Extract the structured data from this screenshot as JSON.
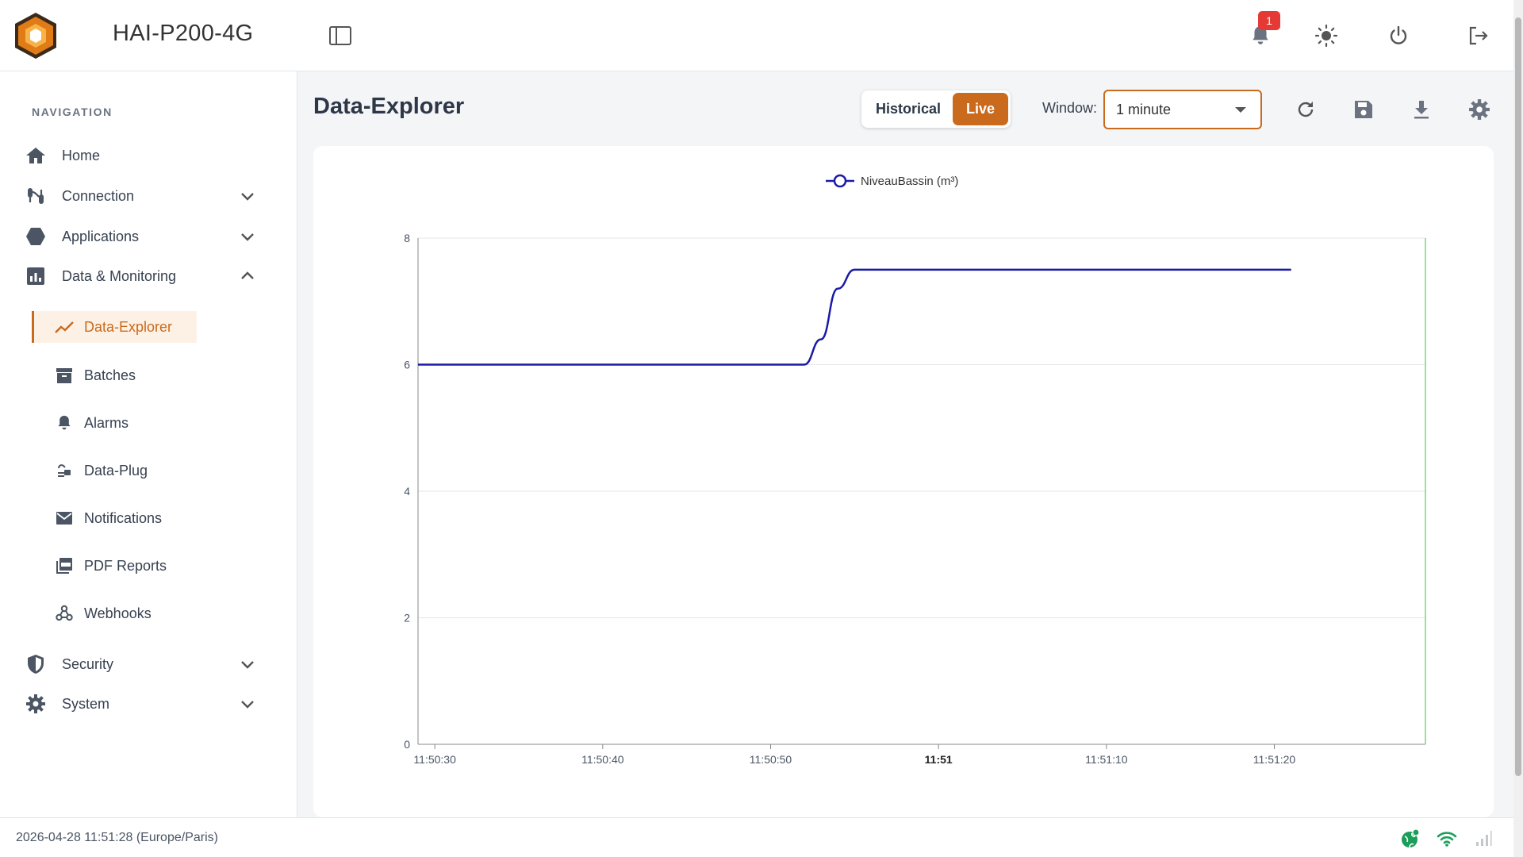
{
  "header": {
    "app_title": "HAI-P200-4G",
    "notification_count": "1",
    "icons": [
      "sidebar-toggle-icon",
      "bell-icon",
      "sun-icon",
      "power-icon",
      "logout-icon"
    ]
  },
  "sidebar": {
    "section_label": "NAVIGATION",
    "items": [
      {
        "label": "Home",
        "icon": "home-icon"
      },
      {
        "label": "Connection",
        "icon": "connection-icon"
      },
      {
        "label": "Applications",
        "icon": "hexagon-icon"
      },
      {
        "label": "Data & Monitoring",
        "icon": "chart-box-icon"
      }
    ],
    "sub_items": [
      {
        "label": "Data-Explorer",
        "icon": "trending-icon",
        "active": true
      },
      {
        "label": "Batches",
        "icon": "archive-icon"
      },
      {
        "label": "Alarms",
        "icon": "bell-icon"
      },
      {
        "label": "Data-Plug",
        "icon": "plug-icon"
      },
      {
        "label": "Notifications",
        "icon": "mail-icon"
      },
      {
        "label": "PDF Reports",
        "icon": "pdf-icon"
      },
      {
        "label": "Webhooks",
        "icon": "webhook-icon"
      }
    ],
    "bottom_items": [
      {
        "label": "Security",
        "icon": "shield-icon"
      },
      {
        "label": "System",
        "icon": "gear-icon"
      }
    ]
  },
  "main": {
    "page_title": "Data-Explorer",
    "mode": {
      "historical_label": "Historical",
      "live_label": "Live",
      "selected": "Live"
    },
    "window_label": "Window:",
    "window_value": "1 minute",
    "toolbar_icons": [
      "refresh-icon",
      "save-icon",
      "download-icon",
      "settings-icon"
    ]
  },
  "colors": {
    "accent": "#c96a1c",
    "series": "#1a1aa6",
    "badge": "#e53935"
  },
  "chart_data": {
    "type": "line",
    "title": "",
    "xlabel": "",
    "ylabel": "",
    "legend": [
      {
        "name": "NiveauBassin (m³)"
      }
    ],
    "legend_position": "top-center",
    "ylim": [
      0,
      8
    ],
    "yticks": [
      0,
      2,
      4,
      6,
      8
    ],
    "xlim": [
      "11:50:29",
      "11:51:29"
    ],
    "xticks": [
      "11:50:30",
      "11:50:40",
      "11:50:50",
      "11:51",
      "11:51:10",
      "11:51:20"
    ],
    "grid": true,
    "series": [
      {
        "name": "NiveauBassin (m³)",
        "x": [
          "11:50:29",
          "11:50:52",
          "11:50:53",
          "11:50:54",
          "11:50:55",
          "11:51:21"
        ],
        "y": [
          6,
          6,
          6.4,
          7.2,
          7.5,
          7.5
        ]
      }
    ]
  },
  "footer": {
    "datetime": "2026-04-28 11:51:28 (Europe/Paris)",
    "status_icons": [
      "globe-status-icon",
      "wifi-icon",
      "signal-icon"
    ]
  }
}
